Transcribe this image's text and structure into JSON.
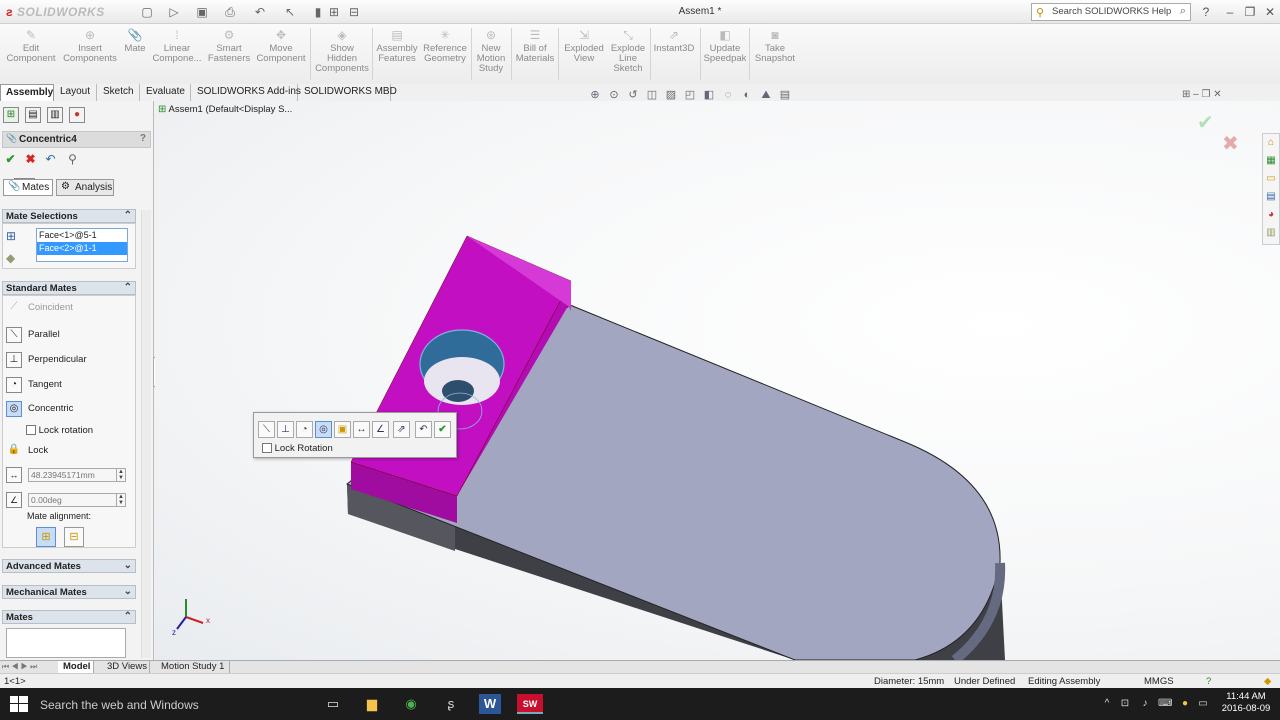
{
  "app": {
    "logo": "SOLIDWORKS",
    "document_title": "Assem1 *",
    "search_placeholder": "Search SOLIDWORKS Help",
    "quick_access": [
      "new-icon",
      "open-icon",
      "save-icon",
      "print-icon",
      "undo-icon",
      "select-icon",
      "rebuild-icon",
      "file-properties-icon",
      "options-icon"
    ]
  },
  "command_manager": [
    {
      "label": "Edit\nComponent",
      "icon": "edit-component-icon"
    },
    {
      "label": "Insert\nComponents",
      "icon": "insert-components-icon"
    },
    {
      "label": "Mate",
      "icon": "mate-icon"
    },
    {
      "label": "Linear\nCompone...",
      "icon": "linear-pattern-icon"
    },
    {
      "label": "Smart\nFasteners",
      "icon": "smart-fasteners-icon"
    },
    {
      "label": "Move\nComponent",
      "icon": "move-component-icon"
    },
    {
      "label": "Show\nHidden\nComponents",
      "icon": "show-hidden-icon"
    },
    {
      "label": "Assembly\nFeatures",
      "icon": "assembly-features-icon"
    },
    {
      "label": "Reference\nGeometry",
      "icon": "reference-geometry-icon"
    },
    {
      "label": "New\nMotion\nStudy",
      "icon": "motion-study-icon"
    },
    {
      "label": "Bill of\nMaterials",
      "icon": "bom-icon"
    },
    {
      "label": "Exploded\nView",
      "icon": "exploded-view-icon"
    },
    {
      "label": "Explode\nLine\nSketch",
      "icon": "explode-line-icon"
    },
    {
      "label": "Instant3D",
      "icon": "instant3d-icon"
    },
    {
      "label": "Update\nSpeedpak",
      "icon": "speedpak-icon"
    },
    {
      "label": "Take\nSnapshot",
      "icon": "snapshot-icon"
    }
  ],
  "tabs": [
    "Assembly",
    "Layout",
    "Sketch",
    "Evaluate",
    "SOLIDWORKS Add-ins",
    "SOLIDWORKS MBD"
  ],
  "property_manager": {
    "title": "Concentric4",
    "help": "?",
    "ok_tooltip": "OK",
    "subtabs": {
      "mates": "Mates",
      "analysis": "Analysis"
    },
    "mate_selections": {
      "header": "Mate Selections",
      "items": [
        "Face<1>@5-1",
        "Face<2>@1-1"
      ]
    },
    "standard_mates": {
      "header": "Standard Mates",
      "coincident": "Coincident",
      "parallel": "Parallel",
      "perpendicular": "Perpendicular",
      "tangent": "Tangent",
      "concentric": "Concentric",
      "lock_rotation": "Lock rotation",
      "lock": "Lock",
      "distance": "48.23945171mm",
      "angle": "0.00deg",
      "alignment_label": "Mate alignment:"
    },
    "advanced_header": "Advanced Mates",
    "mechanical_header": "Mechanical Mates",
    "mates_header": "Mates"
  },
  "viewport": {
    "tree_item": "Assem1  (Default<Display S...",
    "context_lock": "Lock Rotation",
    "colors": {
      "block": "#c20fc2",
      "block_top": "#d63ad6",
      "block_side": "#a00ba0",
      "plate_top": "#a3a6c0",
      "plate_side": "#55565e",
      "plate_dark": "#3f4046"
    }
  },
  "bottom_tabs": [
    "Model",
    "3D Views",
    "Motion Study 1"
  ],
  "status": {
    "left": "1<1>",
    "diameter": "Diameter: 15mm",
    "state": "Under Defined",
    "mode": "Editing Assembly",
    "units": "MMGS"
  },
  "taskbar": {
    "search": "Search the web and Windows",
    "time": "11:44 AM",
    "date": "2016-08-09"
  }
}
